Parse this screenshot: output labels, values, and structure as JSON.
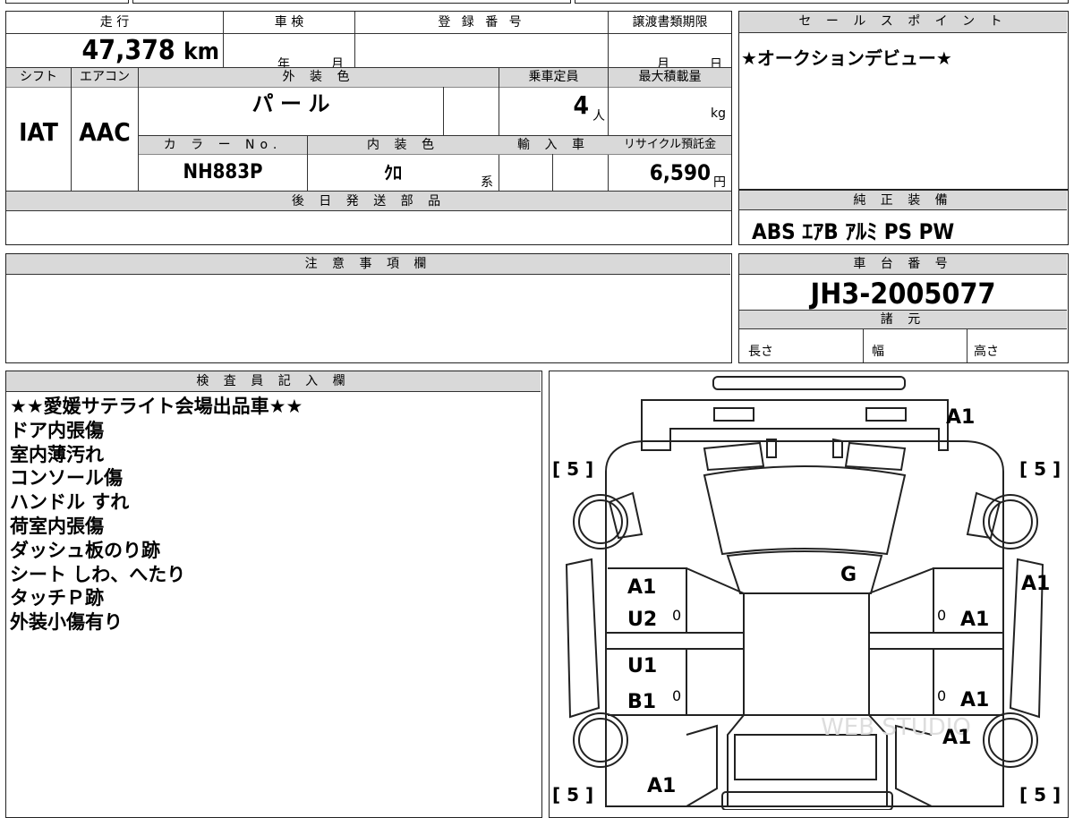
{
  "vehicle": {
    "mileage_label": "走 行",
    "mileage": "47,378",
    "mileage_unit": "km",
    "inspection_label": "車 検",
    "inspection_year_unit": "年",
    "inspection_month_unit": "月",
    "registration_label": "登 録 番 号",
    "transfer_deadline_label": "譲渡書類期限",
    "transfer_month_unit": "月",
    "transfer_day_unit": "日",
    "shift_label": "シフト",
    "shift": "IAT",
    "ac_label": "エアコン",
    "ac": "AAC",
    "exterior_color_label": "外 装 色",
    "exterior_color": "パ ー ル",
    "capacity_label": "乗車定員",
    "capacity": "4",
    "capacity_unit": "人",
    "max_load_label": "最大積載量",
    "max_load_unit": "kg",
    "color_no_label": "カ ラ ー No.",
    "color_no": "NH883P",
    "interior_color_label": "内 装 色",
    "interior_color": "ｸﾛ",
    "interior_color_suffix": "系",
    "import_label": "輸 入 車",
    "recycle_label": "リサイクル預託金",
    "recycle_fee": "6,590",
    "recycle_unit": "円",
    "later_parts_label": "後 日 発 送 部 品"
  },
  "sales_point": {
    "label": "セ ー ル ス ポ イ ン ト",
    "text": "★オークションデビュー★"
  },
  "equipment": {
    "label": "純 正 装 備",
    "text": "ABS ｴｱB ｱﾙﾐ PS PW"
  },
  "notes": {
    "label": "注 意 事 項 欄"
  },
  "chassis": {
    "label": "車 台 番 号",
    "number": "JH3-2005077"
  },
  "specs": {
    "label": "諸 元",
    "length_label": "長さ",
    "width_label": "幅",
    "height_label": "高さ"
  },
  "inspector": {
    "label": "検 査 員 記 入 欄",
    "remarks": [
      "★★愛媛サテライト会場出品車★★",
      "ドア内張傷",
      "室内薄汚れ",
      "コンソール傷",
      "ハンドル すれ",
      "荷室内張傷",
      "ダッシュ板のり跡",
      "シート しわ、へたり",
      "タッチＰ跡",
      "外装小傷有り"
    ]
  },
  "diagram": {
    "marks": {
      "front": "A1",
      "roof": "G",
      "left_front_door_1": "A1",
      "left_front_door_2": "U2",
      "left_rear_door_1": "U1",
      "left_rear_door_2": "B1",
      "right_fender": "A1",
      "right_front_door": "A1",
      "right_rear_door": "A1",
      "right_quarter": "A1",
      "left_rear": "A1",
      "tire_fl": "[ 5 ]",
      "tire_fr": "[ 5 ]",
      "tire_rl": "[ 5 ]",
      "tire_rr": "[ 5 ]",
      "zero_1": "0",
      "zero_2": "0",
      "zero_3": "0",
      "zero_4": "0"
    },
    "watermark": "WEB STUDIO"
  }
}
